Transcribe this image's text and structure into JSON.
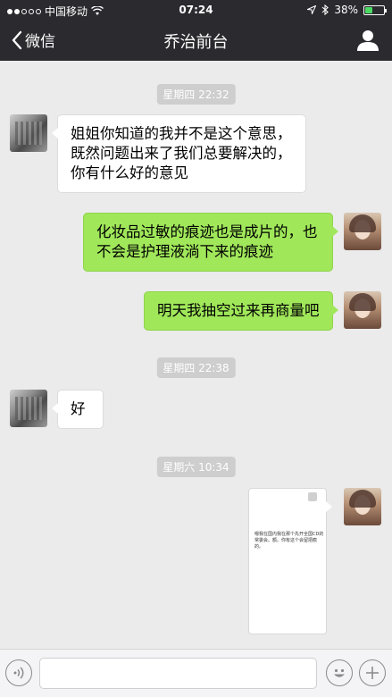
{
  "status": {
    "carrier": "中国移动",
    "time": "07:24",
    "battery": "38%",
    "battery_level": 0.38
  },
  "nav": {
    "back_label": "微信",
    "title": "乔治前台"
  },
  "messages": {
    "t1": "星期四 22:32",
    "m1": "姐姐你知道的我并不是这个意思，既然问题出来了我们总要解决的，你有什么好的意见",
    "m2": "化妆品过敏的痕迹也是成片的，也不会是护理液淌下来的痕迹",
    "m3": "明天我抽空过来再商量吧",
    "t2": "星期四 22:38",
    "m4": "好",
    "t3": "星期六 10:34",
    "img_text": "嗯我在国内我在那个先开全国CD的常委会。额。你有这个会留把痕的。"
  },
  "icons": {
    "back": "chevron-left-icon",
    "profile": "person-icon",
    "voice": "voice-icon",
    "emoji": "emoji-icon",
    "plus": "plus-icon",
    "wifi": "wifi-icon",
    "location": "location-arrow-icon",
    "bluetooth": "bluetooth-icon"
  },
  "colors": {
    "nav_bg": "#2a2a2f",
    "chat_bg": "#ebebeb",
    "out_bubble": "#a0e75a",
    "in_bubble": "#ffffff"
  }
}
